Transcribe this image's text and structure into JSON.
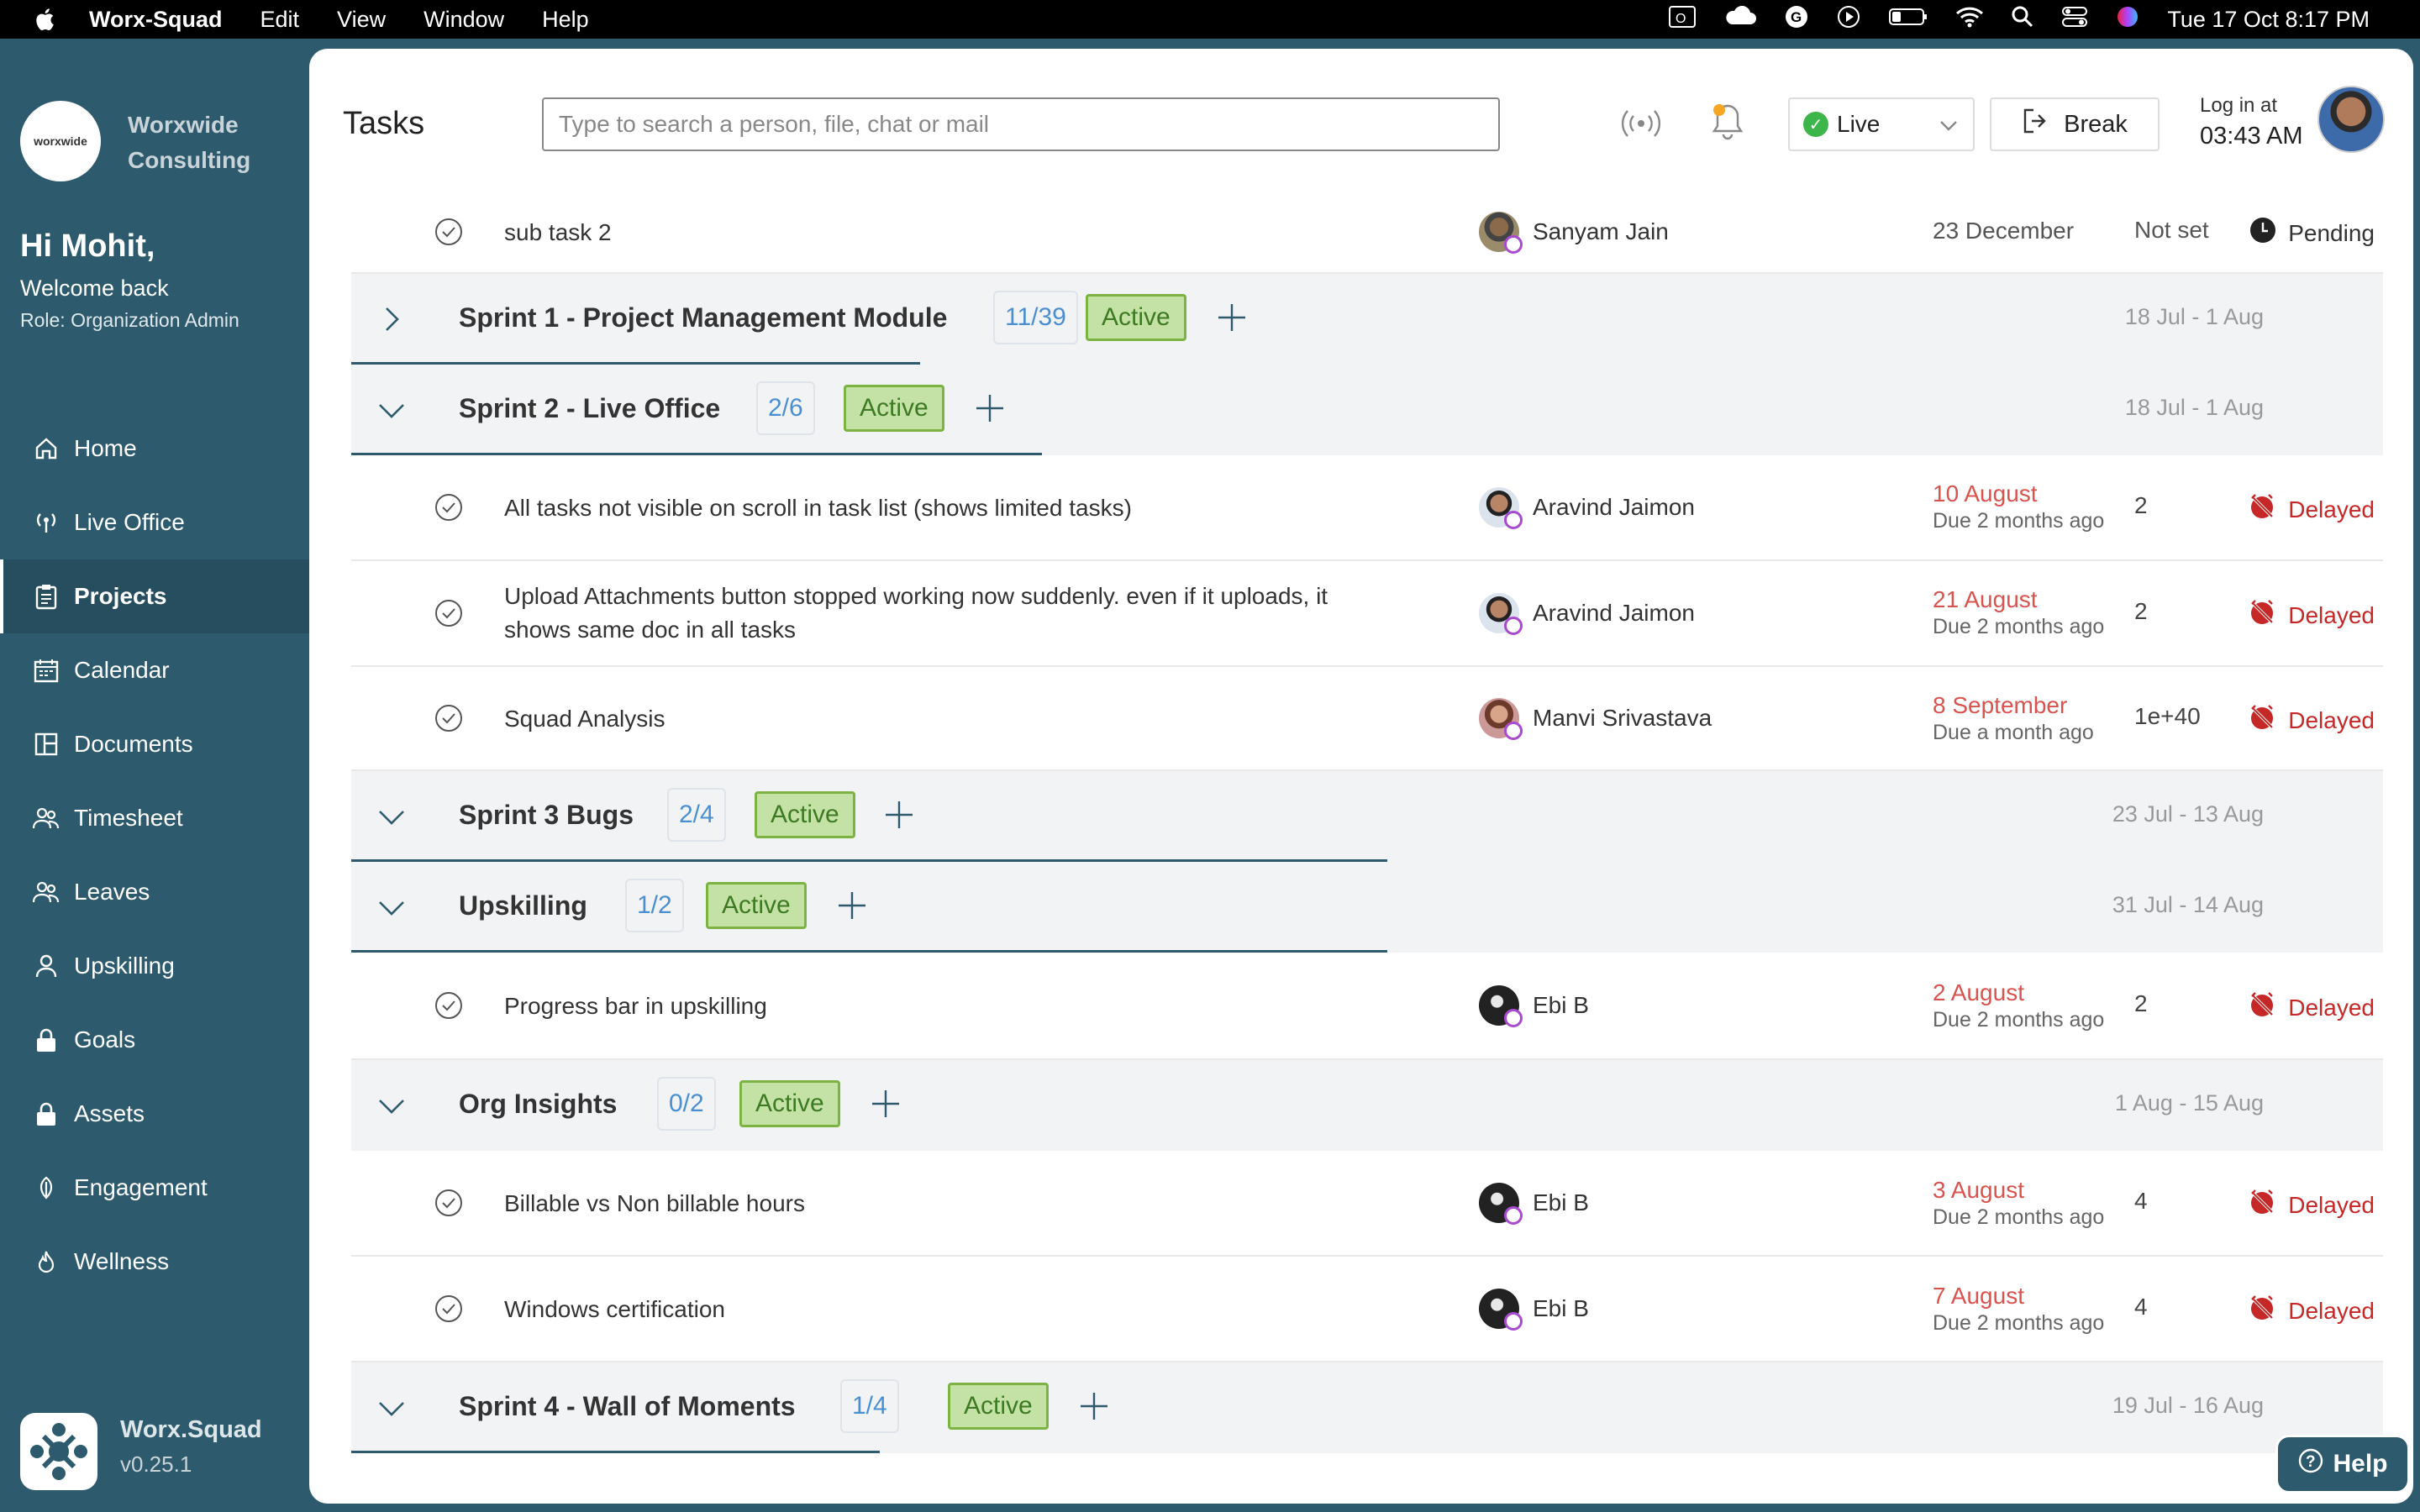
{
  "menubar": {
    "app": "Worx-Squad",
    "items": [
      "Edit",
      "View",
      "Window",
      "Help"
    ],
    "datetime": "Tue 17 Oct  8:17 PM"
  },
  "sidebar": {
    "org_name_1": "Worxwide",
    "org_name_2": "Consulting",
    "logo_text": "worxwide",
    "greeting": "Hi Mohit,",
    "welcome": "Welcome back",
    "role": "Role: Organization Admin",
    "items": [
      {
        "label": "Home",
        "icon": "home-icon"
      },
      {
        "label": "Live Office",
        "icon": "broadcast-icon"
      },
      {
        "label": "Projects",
        "icon": "clipboard-icon",
        "active": true
      },
      {
        "label": "Calendar",
        "icon": "calendar-icon"
      },
      {
        "label": "Documents",
        "icon": "documents-icon"
      },
      {
        "label": "Timesheet",
        "icon": "people-icon"
      },
      {
        "label": "Leaves",
        "icon": "people-icon"
      },
      {
        "label": "Upskilling",
        "icon": "person-icon"
      },
      {
        "label": "Goals",
        "icon": "lock-icon"
      },
      {
        "label": "Assets",
        "icon": "lock-icon"
      },
      {
        "label": "Engagement",
        "icon": "leaf-icon"
      },
      {
        "label": "Wellness",
        "icon": "flame-icon"
      }
    ],
    "brand_name": "Worx.Squad",
    "version": "v0.25.1"
  },
  "header": {
    "title": "Tasks",
    "search_placeholder": "Type to search a person, file, chat or mail",
    "status": "Live",
    "break_label": "Break",
    "login_label": "Log in at",
    "login_time": "03:43 AM"
  },
  "tasks": {
    "top": {
      "name": "sub task 2",
      "assignee": "Sanyam Jain",
      "date": "23 December",
      "hours": "Not set",
      "status": "Pending"
    },
    "groups": [
      {
        "name": "Sprint 1 - Project Management Module",
        "count": "11/39",
        "status": "Active",
        "dates": "18 Jul - 1 Aug",
        "progress": 0.28
      },
      {
        "name": "Sprint 2 - Live Office",
        "count": "2/6",
        "status": "Active",
        "dates": "18 Jul - 1 Aug",
        "progress": 0.34
      },
      {
        "name": "Sprint 3 Bugs",
        "count": "2/4",
        "status": "Active",
        "dates": "23 Jul - 13 Aug",
        "progress": 0.51
      },
      {
        "name": "Upskilling",
        "count": "1/2",
        "status": "Active",
        "dates": "31 Jul - 14 Aug",
        "progress": 0.51
      },
      {
        "name": "Org Insights",
        "count": "0/2",
        "status": "Active",
        "dates": "1 Aug - 15 Aug",
        "progress": 0
      },
      {
        "name": "Sprint 4 - Wall of Moments",
        "count": "1/4",
        "status": "Active",
        "dates": "19 Jul - 16 Aug",
        "progress": 0.26
      }
    ],
    "sprint2": [
      {
        "name": "All tasks not visible on scroll in task list (shows limited tasks)",
        "assignee": "Aravind Jaimon",
        "date": "10 August",
        "due": "Due 2 months ago",
        "hours": "2",
        "status": "Delayed"
      },
      {
        "name": "Upload Attachments button stopped working now suddenly. even if it uploads, it",
        "name2": "shows same doc in all tasks",
        "assignee": "Aravind Jaimon",
        "date": "21 August",
        "due": "Due 2 months ago",
        "hours": "2",
        "status": "Delayed"
      },
      {
        "name": "Squad Analysis",
        "assignee": "Manvi Srivastava",
        "date": "8 September",
        "due": "Due a month ago",
        "hours": "1e+40",
        "status": "Delayed"
      }
    ],
    "upskilling": [
      {
        "name": "Progress bar in upskilling",
        "assignee": "Ebi B",
        "date": "2 August",
        "due": "Due 2 months ago",
        "hours": "2",
        "status": "Delayed"
      }
    ],
    "org": [
      {
        "name": "Billable vs Non billable hours",
        "assignee": "Ebi B",
        "date": "3 August",
        "due": "Due 2 months ago",
        "hours": "4",
        "status": "Delayed"
      },
      {
        "name": "Windows certification",
        "assignee": "Ebi B",
        "date": "7 August",
        "due": "Due 2 months ago",
        "hours": "4",
        "status": "Delayed"
      }
    ]
  },
  "help_label": "Help"
}
